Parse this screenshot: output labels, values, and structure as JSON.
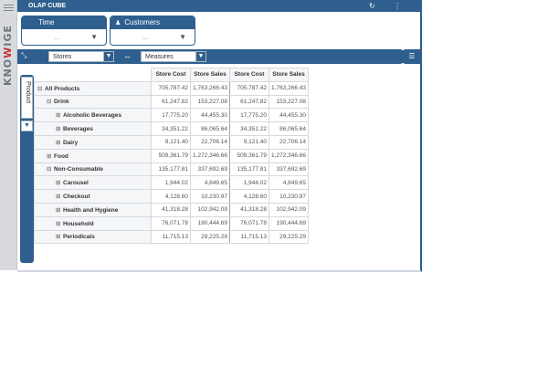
{
  "brand": {
    "prefix": "KNO",
    "w": "W",
    "suffix": "IGE"
  },
  "titlebar": {
    "title": "OLAP CUBE",
    "refresh_icon": "↻",
    "menu_icon": "⋮"
  },
  "filters": [
    {
      "label": "Time",
      "value": "...",
      "icon": "filter-icon"
    },
    {
      "label": "Customers",
      "value": "...",
      "icon": "filter-icon",
      "header_icon": "user-icon"
    }
  ],
  "axes": {
    "columns_label": "Stores",
    "measures_label": "Measures",
    "swap_icon": "↔",
    "rows_label": "Product"
  },
  "table": {
    "headers": [
      "Store Cost",
      "Store Sales",
      "Store Cost",
      "Store Sales"
    ],
    "rows": [
      {
        "indent": 0,
        "expander": "⊟",
        "label": "All Products",
        "values": [
          "705,787.42",
          "1,763,266.43",
          "705,787.42",
          "1,763,266.43"
        ]
      },
      {
        "indent": 1,
        "expander": "⊟",
        "label": "Drink",
        "values": [
          "61,247.82",
          "153,227.08",
          "61,247.82",
          "153,227.08"
        ]
      },
      {
        "indent": 2,
        "expander": "⊞",
        "label": "Alcoholic Beverages",
        "values": [
          "17,775.20",
          "44,455.30",
          "17,775.20",
          "44,455.30"
        ]
      },
      {
        "indent": 2,
        "expander": "⊞",
        "label": "Beverages",
        "values": [
          "34,351.22",
          "86,065.64",
          "34,351.22",
          "86,065.64"
        ]
      },
      {
        "indent": 2,
        "expander": "⊞",
        "label": "Dairy",
        "values": [
          "9,121.40",
          "22,706.14",
          "9,121.40",
          "22,706.14"
        ]
      },
      {
        "indent": 1,
        "expander": "⊞",
        "label": "Food",
        "values": [
          "509,361.79",
          "1,272,346.66",
          "509,361.79",
          "1,272,346.66"
        ]
      },
      {
        "indent": 1,
        "expander": "⊟",
        "label": "Non-Consumable",
        "values": [
          "135,177.81",
          "337,692.69",
          "135,177.81",
          "337,692.69"
        ]
      },
      {
        "indent": 2,
        "expander": "⊞",
        "label": "Carousel",
        "values": [
          "1,944.02",
          "4,849.65",
          "1,944.02",
          "4,849.65"
        ]
      },
      {
        "indent": 2,
        "expander": "⊞",
        "label": "Checkout",
        "values": [
          "4,128.60",
          "10,230.97",
          "4,128.60",
          "10,230.97"
        ]
      },
      {
        "indent": 2,
        "expander": "⊞",
        "label": "Health and Hygiene",
        "values": [
          "41,318.28",
          "102,942.09",
          "41,318.28",
          "102,942.09"
        ]
      },
      {
        "indent": 2,
        "expander": "⊞",
        "label": "Household",
        "values": [
          "76,071.78",
          "190,444.69",
          "76,071.78",
          "190,444.69"
        ]
      },
      {
        "indent": 2,
        "expander": "⊞",
        "label": "Periodicals",
        "values": [
          "11,715.13",
          "29,225.29",
          "11,715.13",
          "29,225.29"
        ]
      }
    ]
  }
}
